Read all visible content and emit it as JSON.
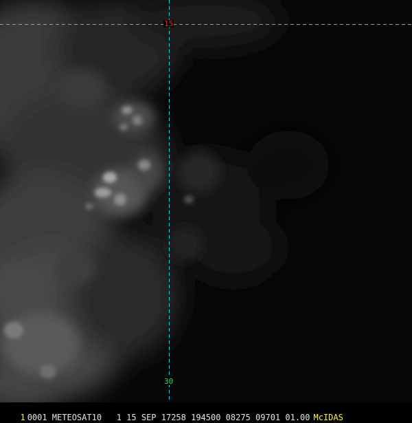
{
  "colors": {
    "grid_line": "#22d3d3",
    "lat_top_label": "#d22b2b",
    "lat_bottom_label": "#31d35a",
    "status_text": "#e6e6e6",
    "frame_number": "#f7f74b",
    "brand": "#f7f74b",
    "cloud_light": "#d8d8d8",
    "background": "#070707"
  },
  "grid": {
    "top_label": "15",
    "bottom_label": "30"
  },
  "status_bar": {
    "frame_number": "1",
    "info": "0001 METEOSAT10   1 15 SEP 17258 194500 08275 09701 01.00",
    "brand": "McIDAS"
  }
}
